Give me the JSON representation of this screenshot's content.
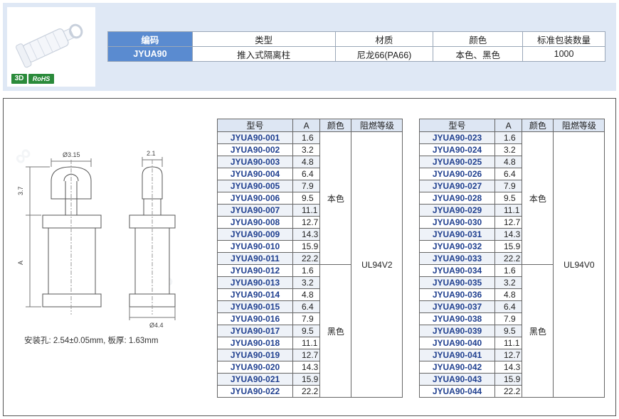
{
  "badges": {
    "three_d": "3D",
    "rohs": "RoHS"
  },
  "spec": {
    "headers": [
      "编码",
      "类型",
      "材质",
      "颜色",
      "标准包装数量"
    ],
    "values": [
      "JYUA90",
      "推入式隔离柱",
      "尼龙66(PA66)",
      "本色、黑色",
      "1000"
    ]
  },
  "drawing": {
    "dim_diameter_top": "Ø3.15",
    "dim_height_top": "3.7",
    "dim_a": "A",
    "dim_width_side": "2.1",
    "dim_diameter_base": "Ø4.4"
  },
  "install_note": "安装孔: 2.54±0.05mm, 板厚: 1.63mm",
  "model_headers": [
    "型号",
    "A",
    "颜色",
    "阻燃等级"
  ],
  "left_table": {
    "flame": "UL94V2",
    "color_natural": "本色",
    "color_black": "黑色",
    "rows": [
      {
        "model": "JYUA90-001",
        "a": "1.6"
      },
      {
        "model": "JYUA90-002",
        "a": "3.2"
      },
      {
        "model": "JYUA90-003",
        "a": "4.8"
      },
      {
        "model": "JYUA90-004",
        "a": "6.4"
      },
      {
        "model": "JYUA90-005",
        "a": "7.9"
      },
      {
        "model": "JYUA90-006",
        "a": "9.5"
      },
      {
        "model": "JYUA90-007",
        "a": "11.1"
      },
      {
        "model": "JYUA90-008",
        "a": "12.7"
      },
      {
        "model": "JYUA90-009",
        "a": "14.3"
      },
      {
        "model": "JYUA90-010",
        "a": "15.9"
      },
      {
        "model": "JYUA90-011",
        "a": "22.2"
      },
      {
        "model": "JYUA90-012",
        "a": "1.6"
      },
      {
        "model": "JYUA90-013",
        "a": "3.2"
      },
      {
        "model": "JYUA90-014",
        "a": "4.8"
      },
      {
        "model": "JYUA90-015",
        "a": "6.4"
      },
      {
        "model": "JYUA90-016",
        "a": "7.9"
      },
      {
        "model": "JYUA90-017",
        "a": "9.5"
      },
      {
        "model": "JYUA90-018",
        "a": "11.1"
      },
      {
        "model": "JYUA90-019",
        "a": "12.7"
      },
      {
        "model": "JYUA90-020",
        "a": "14.3"
      },
      {
        "model": "JYUA90-021",
        "a": "15.9"
      },
      {
        "model": "JYUA90-022",
        "a": "22.2"
      }
    ]
  },
  "right_table": {
    "flame": "UL94V0",
    "color_natural": "本色",
    "color_black": "黑色",
    "rows": [
      {
        "model": "JYUA90-023",
        "a": "1.6"
      },
      {
        "model": "JYUA90-024",
        "a": "3.2"
      },
      {
        "model": "JYUA90-025",
        "a": "4.8"
      },
      {
        "model": "JYUA90-026",
        "a": "6.4"
      },
      {
        "model": "JYUA90-027",
        "a": "7.9"
      },
      {
        "model": "JYUA90-028",
        "a": "9.5"
      },
      {
        "model": "JYUA90-029",
        "a": "11.1"
      },
      {
        "model": "JYUA90-030",
        "a": "12.7"
      },
      {
        "model": "JYUA90-031",
        "a": "14.3"
      },
      {
        "model": "JYUA90-032",
        "a": "15.9"
      },
      {
        "model": "JYUA90-033",
        "a": "22.2"
      },
      {
        "model": "JYUA90-034",
        "a": "1.6"
      },
      {
        "model": "JYUA90-035",
        "a": "3.2"
      },
      {
        "model": "JYUA90-036",
        "a": "4.8"
      },
      {
        "model": "JYUA90-037",
        "a": "6.4"
      },
      {
        "model": "JYUA90-038",
        "a": "7.9"
      },
      {
        "model": "JYUA90-039",
        "a": "9.5"
      },
      {
        "model": "JYUA90-040",
        "a": "11.1"
      },
      {
        "model": "JYUA90-041",
        "a": "12.7"
      },
      {
        "model": "JYUA90-042",
        "a": "14.3"
      },
      {
        "model": "JYUA90-043",
        "a": "15.9"
      },
      {
        "model": "JYUA90-044",
        "a": "22.2"
      }
    ]
  },
  "colors": {
    "header_blue": "#5a8bd0",
    "model_blue": "#1f3f8f",
    "band": "#dfe8f5",
    "badge_green": "#2a8a3a"
  }
}
